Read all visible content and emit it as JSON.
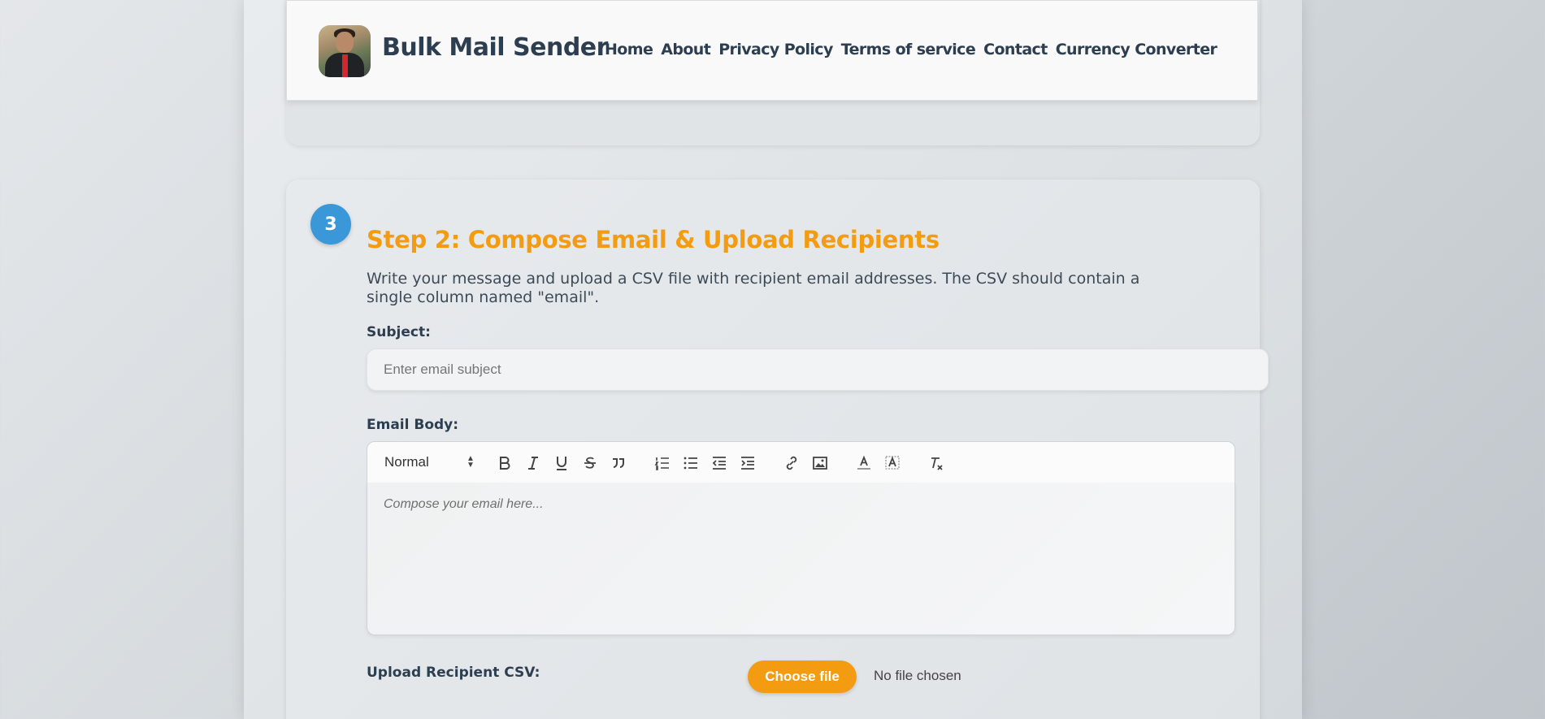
{
  "brand": {
    "name": "Bulk Mail Sender"
  },
  "nav": {
    "items": [
      {
        "label": "Home"
      },
      {
        "label": "About"
      },
      {
        "label": "Privacy Policy"
      },
      {
        "label": "Terms of service"
      },
      {
        "label": "Contact"
      },
      {
        "label": "Currency Converter"
      }
    ]
  },
  "step": {
    "number": "3",
    "title": "Step 2: Compose Email & Upload Recipients",
    "description": "Write your message and upload a CSV file with recipient email addresses. The CSV should contain a single column named \"email\"."
  },
  "form": {
    "subject_label": "Subject:",
    "subject_placeholder": "Enter email subject",
    "subject_value": "",
    "body_label": "Email Body:",
    "format_select": "Normal",
    "toolbar_icons": [
      "bold-icon",
      "italic-icon",
      "underline-icon",
      "strikethrough-icon",
      "blockquote-icon",
      "ordered-list-icon",
      "bullet-list-icon",
      "outdent-icon",
      "indent-icon",
      "link-icon",
      "image-icon",
      "text-color-icon",
      "background-color-icon",
      "clear-format-icon"
    ],
    "body_placeholder": "Compose your email here...",
    "csv_label": "Upload Recipient CSV:",
    "choose_file_label": "Choose file",
    "file_status": "No file chosen"
  },
  "colors": {
    "accent": "#f39c12",
    "badge": "#3a98d8",
    "heading": "#2c3e50"
  }
}
